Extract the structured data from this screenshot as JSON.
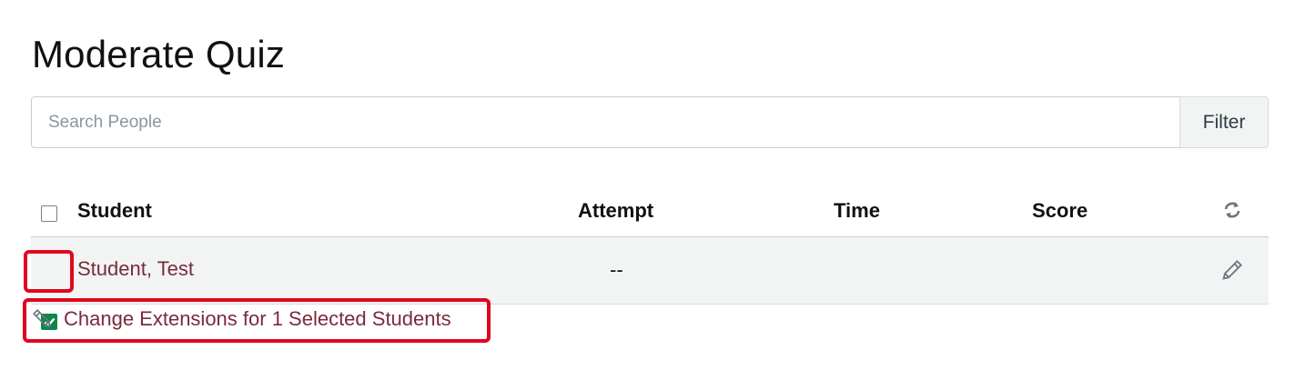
{
  "page": {
    "title": "Moderate Quiz"
  },
  "search": {
    "placeholder": "Search People",
    "filter_label": "Filter"
  },
  "table": {
    "headers": {
      "student": "Student",
      "attempt": "Attempt",
      "time": "Time",
      "score": "Score"
    },
    "rows": [
      {
        "student": "Student, Test",
        "attempt": "--",
        "time": "",
        "score": "",
        "selected": true
      }
    ]
  },
  "extensions": {
    "label": "Change Extensions for 1 Selected Students"
  },
  "icons": {
    "refresh": "refresh-icon",
    "edit": "pencil-icon",
    "check": "checkmark-icon"
  },
  "colors": {
    "link": "#7a2b3b",
    "checkbox_checked": "#0b874b",
    "highlight": "#e0061f",
    "row_background": "#f2f4f4"
  }
}
